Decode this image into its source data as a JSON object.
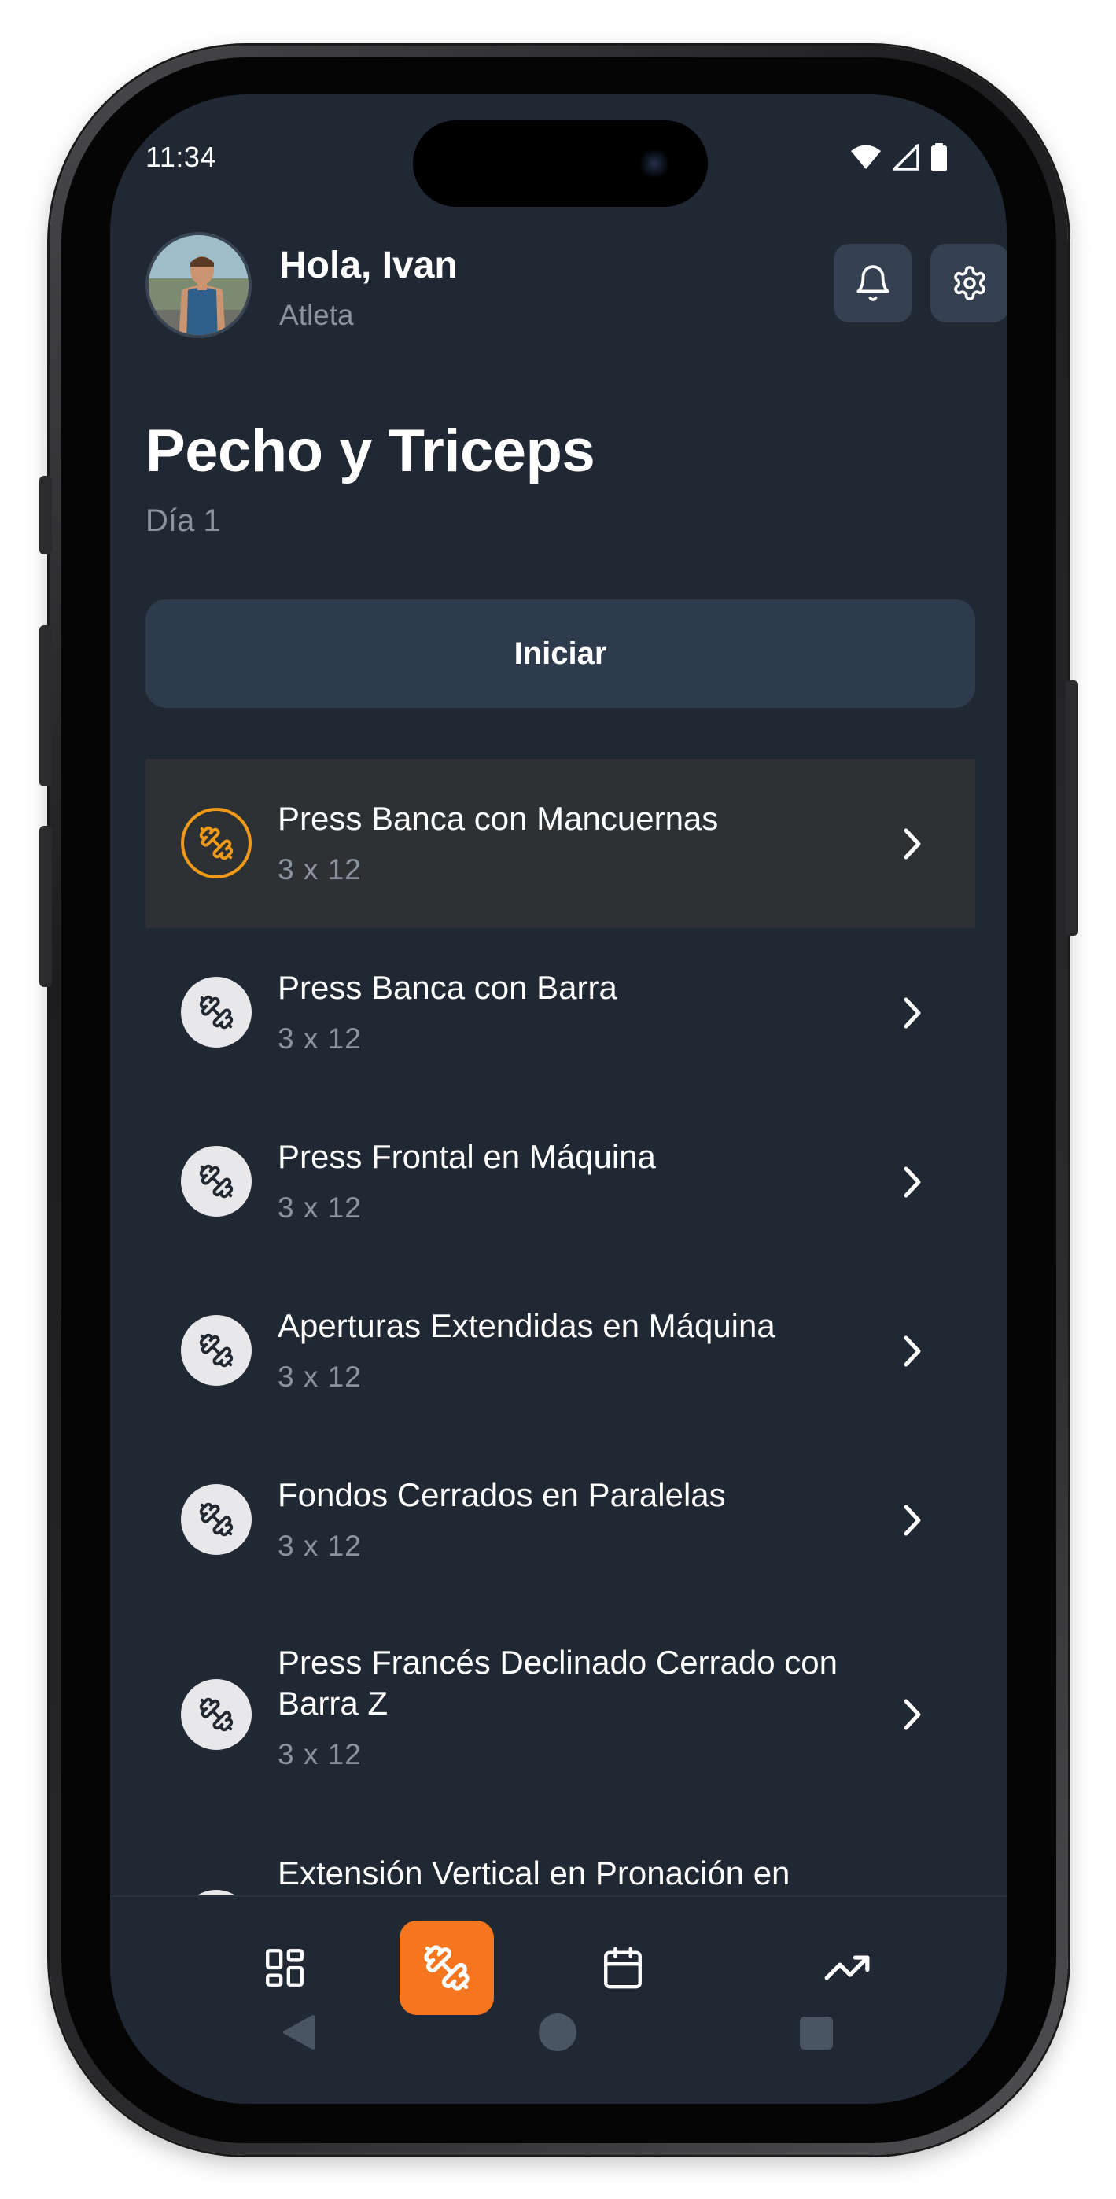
{
  "status_bar": {
    "time": "11:34"
  },
  "user": {
    "greeting": "Hola, Ivan",
    "role": "Atleta"
  },
  "workout": {
    "title": "Pecho y Triceps",
    "day": "Día 1",
    "start_label": "Iniciar"
  },
  "exercises": [
    {
      "name": "Press Banca con Mancuernas",
      "sets": "3 x 12",
      "selected": true
    },
    {
      "name": "Press Banca con Barra",
      "sets": "3 x 12",
      "selected": false
    },
    {
      "name": "Press Frontal en Máquina",
      "sets": "3 x 12",
      "selected": false
    },
    {
      "name": "Aperturas Extendidas en Máquina",
      "sets": "3 x 12",
      "selected": false
    },
    {
      "name": "Fondos Cerrados en Paralelas",
      "sets": "3 x 12",
      "selected": false
    },
    {
      "name": "Press Francés Declinado Cerrado con Barra Z",
      "sets": "3 x 12",
      "selected": false
    },
    {
      "name": "Extensión Vertical en Pronación en",
      "sets": "",
      "selected": false
    }
  ],
  "icons": {
    "notifications": "bell-icon",
    "settings": "gear-icon",
    "exercise": "dumbbell-icon",
    "chevron": "chevron-right-icon",
    "nav_dashboard": "dashboard-grid-icon",
    "nav_workout": "dumbbell-icon",
    "nav_calendar": "calendar-icon",
    "nav_progress": "trending-up-icon"
  },
  "colors": {
    "background": "#1f2833",
    "accent": "#f5761f",
    "selected_ring": "#f09a1a",
    "selected_row": "#2e3133",
    "button": "#2e3b4c",
    "muted_text": "#8a939e"
  }
}
